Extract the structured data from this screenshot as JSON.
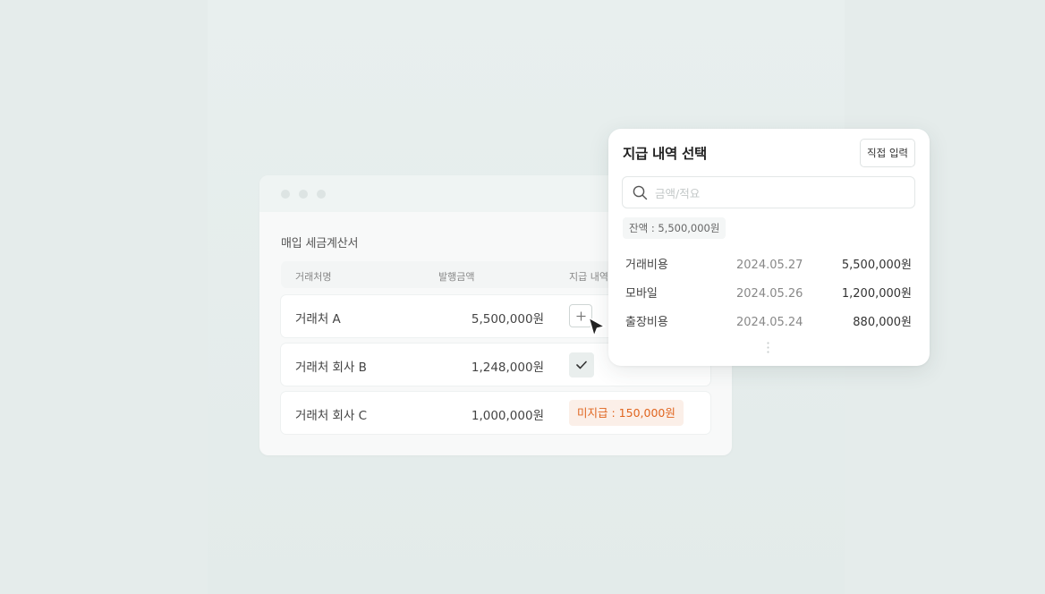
{
  "window": {
    "title": "매입 세금계산서",
    "columns": [
      "거래처명",
      "발행금액",
      "지급 내역"
    ],
    "rows": [
      {
        "vendor": "거래처 A",
        "amount": "5,500,000원",
        "status": "add"
      },
      {
        "vendor": "거래처 회사 B",
        "amount": "1,248,000원",
        "status": "checked"
      },
      {
        "vendor": "거래처 회사 C",
        "amount": "1,000,000원",
        "status": "unpaid",
        "badge": "미지급 : 150,000원"
      }
    ]
  },
  "popover": {
    "title": "지급 내역 선택",
    "direct_input_label": "직접 입력",
    "search": {
      "placeholder": "금액/적요",
      "value": ""
    },
    "balance": "잔액 : 5,500,000원",
    "payments": [
      {
        "category": "거래비용",
        "date": "2024.05.27",
        "amount": "5,500,000원"
      },
      {
        "category": "모바일",
        "date": "2024.05.26",
        "amount": "1,200,000원"
      },
      {
        "category": "출장비용",
        "date": "2024.05.24",
        "amount": "880,000원"
      }
    ]
  },
  "icons": {
    "search": "search-icon",
    "plus": "plus-icon",
    "check": "check-icon",
    "more": "more-vertical-icon",
    "cursor": "mouse-cursor-icon"
  },
  "colors": {
    "unpaid_text": "#e0651f",
    "unpaid_bg": "#fbefe8",
    "background": "#e5eceb"
  }
}
